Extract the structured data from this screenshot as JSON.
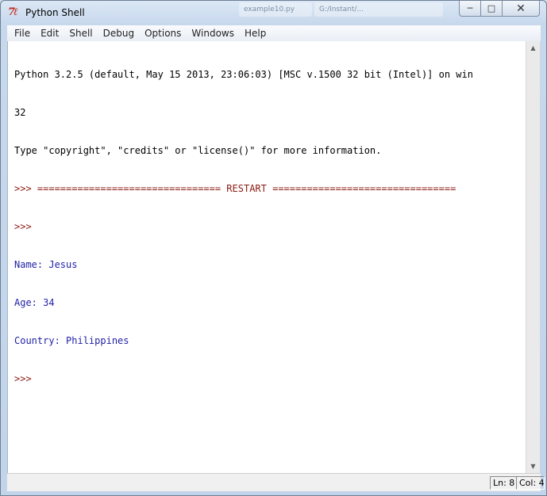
{
  "window": {
    "title": "Python Shell",
    "background_tabs": [
      "example10.py",
      "G:/Instant/..."
    ]
  },
  "menu": [
    "File",
    "Edit",
    "Shell",
    "Debug",
    "Options",
    "Windows",
    "Help"
  ],
  "shell_lines": [
    {
      "text": "Python 3.2.5 (default, May 15 2013, 23:06:03) [MSC v.1500 32 bit (Intel)] on win",
      "color": "#000000"
    },
    {
      "text": "32",
      "color": "#000000"
    },
    {
      "text": "Type \"copyright\", \"credits\" or \"license()\" for more information.",
      "color": "#000000"
    },
    {
      "text": ">>> ================================ RESTART ================================",
      "color": "#8b1c14"
    },
    {
      "text": ">>> ",
      "color": "#8b1c14"
    },
    {
      "text": "Name: Jesus",
      "color": "#1f1fa8"
    },
    {
      "text": "Age: 34",
      "color": "#1f1fa8"
    },
    {
      "text": "Country: Philippines",
      "color": "#1f1fa8"
    },
    {
      "text": ">>> ",
      "color": "#8b1c14"
    }
  ],
  "status": {
    "ln": "Ln: 8",
    "col": "Col: 4"
  },
  "colors": {
    "stdout": "#1f1fa8",
    "prompt": "#8b1c14",
    "text": "#000000"
  }
}
